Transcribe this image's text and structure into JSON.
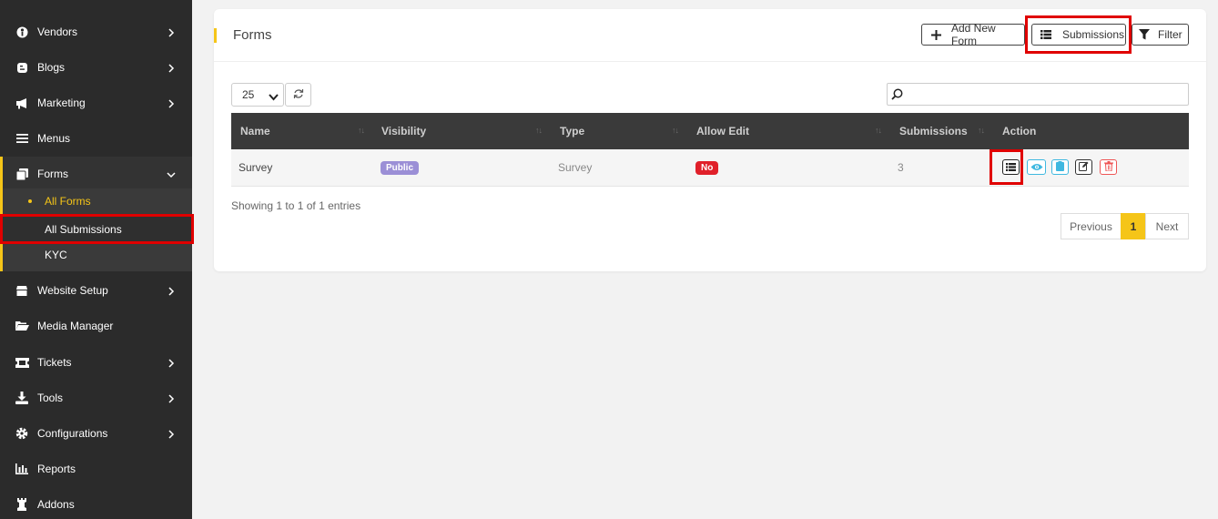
{
  "sidebar": {
    "items": [
      {
        "label": "Vendors",
        "icon": "vendor-icon",
        "chevron": true
      },
      {
        "label": "Blogs",
        "icon": "blog-icon",
        "chevron": true
      },
      {
        "label": "Marketing",
        "icon": "megaphone-icon",
        "chevron": true
      },
      {
        "label": "Menus",
        "icon": "menu-icon",
        "chevron": false
      },
      {
        "label": "Forms",
        "icon": "forms-icon",
        "chevron": "down"
      },
      {
        "label": "Website Setup",
        "icon": "website-setup-icon",
        "chevron": true
      },
      {
        "label": "Media Manager",
        "icon": "folder-icon",
        "chevron": false
      },
      {
        "label": "Tickets",
        "icon": "ticket-icon",
        "chevron": true
      },
      {
        "label": "Tools",
        "icon": "download-icon",
        "chevron": true
      },
      {
        "label": "Configurations",
        "icon": "gear-icon",
        "chevron": true
      },
      {
        "label": "Reports",
        "icon": "bar-chart-icon",
        "chevron": false
      },
      {
        "label": "Addons",
        "icon": "chess-rook-icon",
        "chevron": false
      }
    ],
    "forms_submenu": [
      {
        "label": "All Forms",
        "active": true
      },
      {
        "label": "All Submissions",
        "active": false
      },
      {
        "label": "KYC",
        "active": false
      }
    ]
  },
  "page": {
    "title": "Forms",
    "add_new_form_label": "Add New Form",
    "submissions_label": "Submissions",
    "filter_label": "Filter"
  },
  "table": {
    "page_length": "25",
    "search_value": "",
    "columns": [
      "Name",
      "Visibility",
      "Type",
      "Allow Edit",
      "Submissions",
      "Action"
    ],
    "rows": [
      {
        "name": "Survey",
        "visibility": "Public",
        "type": "Survey",
        "allow_edit": "No",
        "submissions": "3"
      }
    ],
    "info": "Showing 1 to 1 of 1 entries",
    "pagination": {
      "previous": "Previous",
      "current": "1",
      "next": "Next"
    }
  },
  "colors": {
    "accent": "#f5c518",
    "sidebar_bg": "#2b2b2b",
    "public_badge": "#9b8fd6",
    "no_badge": "#e0202a",
    "highlight": "#e00000"
  }
}
